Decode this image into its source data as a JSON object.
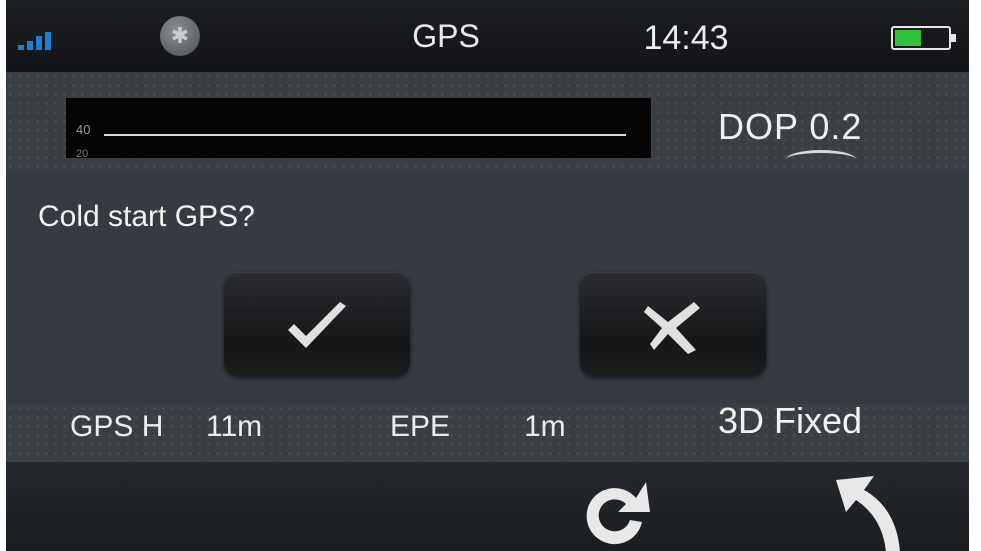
{
  "status_bar": {
    "title": "GPS",
    "time": "14:43",
    "bluetooth_icon": "bluetooth-icon",
    "signal_icon": "signal-strength-icon",
    "battery_icon": "battery-icon",
    "battery_level": 0.5
  },
  "graph": {
    "tick_top": "40",
    "tick_bottom": "20"
  },
  "dop": {
    "text": "DOP  0.2"
  },
  "dialog": {
    "question": "Cold start GPS?",
    "confirm_icon": "checkmark-icon",
    "cancel_icon": "cross-icon"
  },
  "metrics": {
    "gps_h_label": "GPS H",
    "gps_h_value": "11m",
    "epe_label": "EPE",
    "epe_value": "1m",
    "fix_status": "3D Fixed"
  },
  "bottom_bar": {
    "refresh_icon": "refresh-icon",
    "back_icon": "back-arrow-icon"
  },
  "colors": {
    "accent_signal": "#1e7fd0",
    "battery_fill": "#2fc23a",
    "background": "#3a4046"
  }
}
